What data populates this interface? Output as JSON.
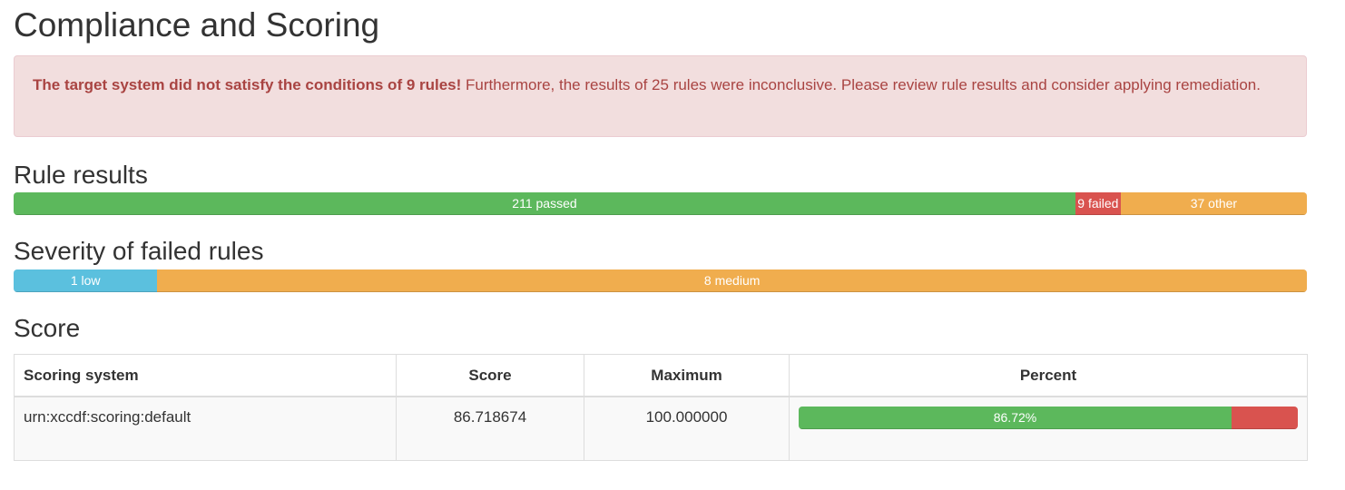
{
  "page": {
    "title": "Compliance and Scoring"
  },
  "alert": {
    "strong": "The target system did not satisfy the conditions of 9 rules!",
    "text": " Furthermore, the results of 25 rules were inconclusive. Please review rule results and consider applying remediation."
  },
  "rule_results": {
    "title": "Rule results",
    "segments": [
      {
        "label": "211 passed",
        "count": 211,
        "color": "#5cb85c"
      },
      {
        "label": "9 failed",
        "count": 9,
        "color": "#d9534f"
      },
      {
        "label": "37 other",
        "count": 37,
        "color": "#f0ad4e"
      }
    ]
  },
  "severity": {
    "title": "Severity of failed rules",
    "segments": [
      {
        "label": "1 low",
        "count": 1,
        "color": "#5bc0de"
      },
      {
        "label": "8 medium",
        "count": 8,
        "color": "#f0ad4e"
      }
    ]
  },
  "score": {
    "title": "Score",
    "headers": {
      "system": "Scoring system",
      "score": "Score",
      "maximum": "Maximum",
      "percent": "Percent"
    },
    "rows": [
      {
        "system": "urn:xccdf:scoring:default",
        "score": "86.718674",
        "maximum": "100.000000",
        "percent_label": "86.72%",
        "percent": 86.72,
        "pass_color": "#5cb85c",
        "fail_color": "#d9534f"
      }
    ]
  }
}
